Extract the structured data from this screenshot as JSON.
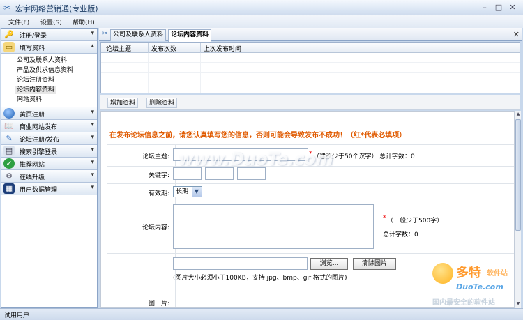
{
  "window": {
    "title": "宏宇网络营销通(专业版)"
  },
  "menu": [
    {
      "label": "文件(F)"
    },
    {
      "label": "设置(S)"
    },
    {
      "label": "帮助(H)"
    }
  ],
  "sidebar": {
    "sections": [
      {
        "label": "注册/登录",
        "icon": "key-icon",
        "chev": "⌄"
      },
      {
        "label": "填写资料",
        "icon": "folder-icon",
        "chev": "⌃"
      },
      {
        "label": "黄页注册",
        "icon": "globe-icon",
        "chev": "⌄"
      },
      {
        "label": "商业网站发布",
        "icon": "book-icon",
        "chev": "⌄"
      },
      {
        "label": "论坛注册/发布",
        "icon": "forum-icon",
        "chev": "⌄"
      },
      {
        "label": "搜索引擎登录",
        "icon": "search-engine-icon",
        "chev": "⌄"
      },
      {
        "label": "推荐网站",
        "icon": "check-icon",
        "chev": "⌄"
      },
      {
        "label": "在线升级",
        "icon": "upgrade-icon",
        "chev": "⌄"
      },
      {
        "label": "用户数据管理",
        "icon": "database-icon",
        "chev": "⌄"
      }
    ],
    "subitems": [
      "公司及联系人资料",
      "产品及供求信息资料",
      "论坛注册资料",
      "论坛内容资料",
      "网站资料"
    ]
  },
  "tabs": [
    {
      "label": "公司及联系人资料"
    },
    {
      "label": "论坛内容资料"
    }
  ],
  "grid": {
    "columns": [
      "论坛主题",
      "发布次数",
      "上次发布时间"
    ]
  },
  "toolbar": {
    "add_label": "增加资料",
    "delete_label": "删除资料"
  },
  "form": {
    "notice": "在发布论坛信息之前，请您认真填写您的信息，否则可能会导致发布不成功！（红*代表必填项）",
    "subject_label": "论坛主题:",
    "subject_req": "*",
    "subject_hint": "（建议少于50个汉字）",
    "subject_count": "总计字数：0",
    "keywords_label": "关键字:",
    "validity_label": "有效期:",
    "validity_value": "长期",
    "content_label": "论坛内容:",
    "content_req": "*",
    "content_hint": "（一般少于500字）",
    "content_count": "总计字数：0",
    "browse_label": "浏览...",
    "clear_image_label": "清除图片",
    "image_hint": "(图片大小必须小于100KB，支持 jpg、bmp、gif 格式的图片)",
    "image_label": "图　片:"
  },
  "status": {
    "text": "试用用户"
  },
  "watermark": {
    "center": "www.DuoTe.com",
    "brand": "多特",
    "brand_small": "软件站",
    "url": "DuoTe.com",
    "slogan": "国内最安全的软件站"
  },
  "colors": {
    "notice": "#e05a00",
    "required": "#ee0000",
    "accent": "#8ba4c7"
  }
}
